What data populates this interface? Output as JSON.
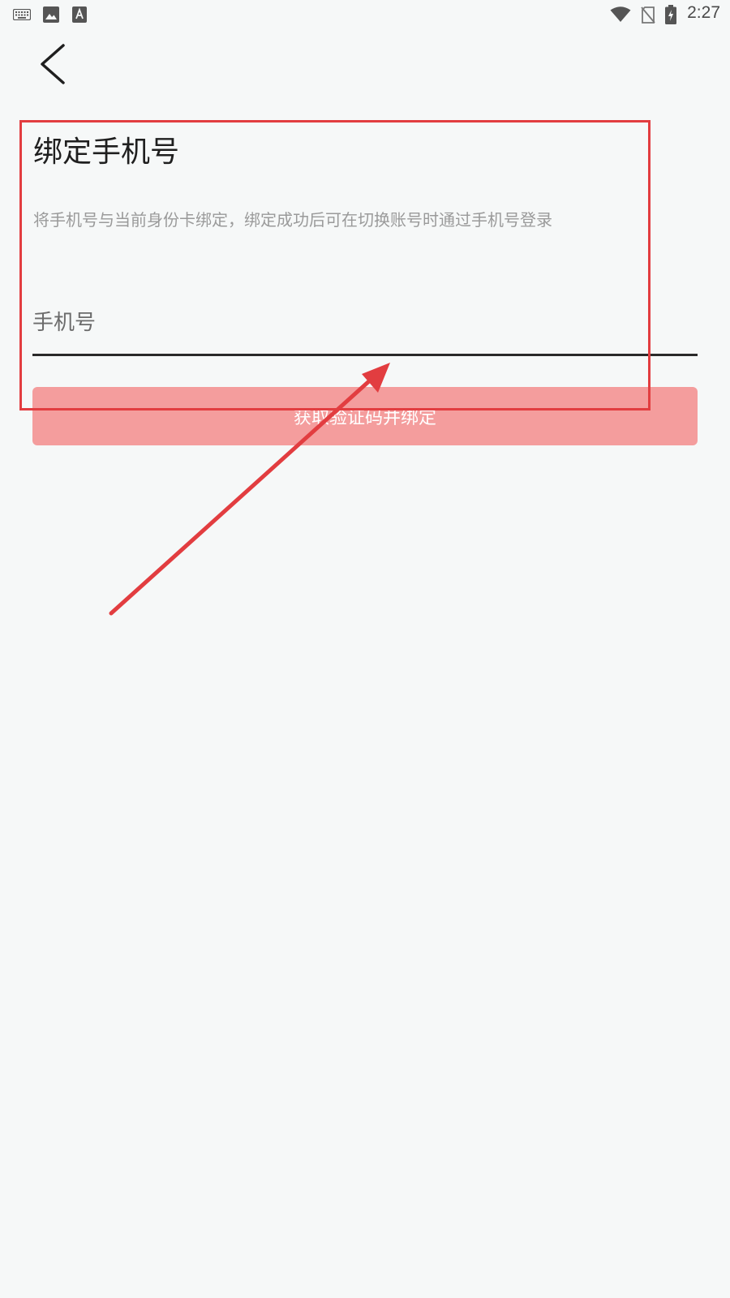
{
  "status_bar": {
    "time": "2:27",
    "left_icons": [
      "keyboard-icon",
      "image-icon",
      "text-a-icon"
    ],
    "right_icons": [
      "wifi-icon",
      "no-sim-icon",
      "battery-charging-icon"
    ]
  },
  "page": {
    "title": "绑定手机号",
    "description": "将手机号与当前身份卡绑定，绑定成功后可在切换账号时通过手机号登录"
  },
  "phone_input": {
    "placeholder": "手机号",
    "value": ""
  },
  "bind_button": {
    "label": "获取验证码并绑定",
    "color": "#f49d9d"
  },
  "colors": {
    "background": "#f6f8f8",
    "annotation": "#e23d40"
  }
}
